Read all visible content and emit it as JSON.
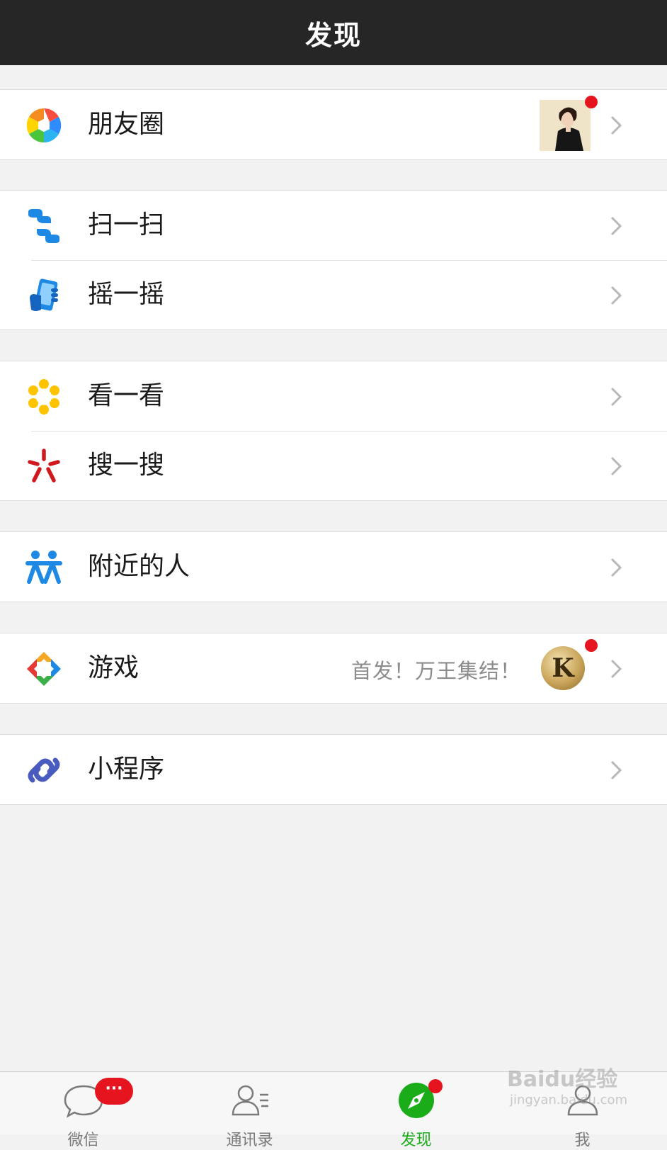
{
  "header": {
    "title": "发现"
  },
  "colors": {
    "header_bg": "#262626",
    "badge_red": "#e6141e",
    "active_green": "#1aad19",
    "promo_gray": "#8c8c8c"
  },
  "groups": [
    {
      "items": [
        {
          "label": "朋友圈",
          "icon": "moments-aperture-icon",
          "has_thumbnail": true,
          "has_dot": true
        }
      ]
    },
    {
      "items": [
        {
          "label": "扫一扫",
          "icon": "scan-icon"
        },
        {
          "label": "摇一摇",
          "icon": "shake-phone-icon"
        }
      ]
    },
    {
      "items": [
        {
          "label": "看一看",
          "icon": "top-stories-icon"
        },
        {
          "label": "搜一搜",
          "icon": "search-burst-icon"
        }
      ]
    },
    {
      "items": [
        {
          "label": "附近的人",
          "icon": "people-nearby-icon"
        }
      ]
    },
    {
      "items": [
        {
          "label": "游戏",
          "icon": "games-icon",
          "promo_text": "首发！万王集结！",
          "promo_logo_letter": "K",
          "has_dot": true
        }
      ]
    },
    {
      "items": [
        {
          "label": "小程序",
          "icon": "mini-program-icon"
        }
      ]
    }
  ],
  "tabbar": {
    "chats_badge": "···",
    "tabs": [
      {
        "label": "微信",
        "icon": "chat-bubble-icon",
        "active": false
      },
      {
        "label": "通讯录",
        "icon": "contacts-icon",
        "active": false
      },
      {
        "label": "发现",
        "icon": "compass-icon",
        "active": true
      },
      {
        "label": "我",
        "icon": "me-person-icon",
        "active": false
      }
    ]
  },
  "watermark": {
    "main": "Baidu经验",
    "sub": "jingyan.baidu.com"
  }
}
